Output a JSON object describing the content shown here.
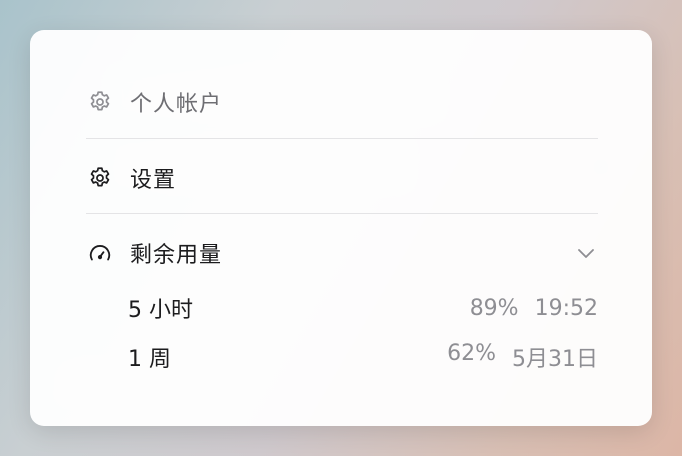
{
  "menu": {
    "account_label": "个人帐户",
    "settings_label": "设置",
    "usage_label": "剩余用量"
  },
  "usage": [
    {
      "name": "5 小时",
      "percent": "89%",
      "reset": "19:52"
    },
    {
      "name": "1 周",
      "percent": "62%",
      "reset": "5月31日"
    }
  ],
  "colors": {
    "panel_bg": "#ffffff",
    "text_primary": "#1c1c1e",
    "text_secondary": "#8e8e93",
    "icon_muted": "#8e8e93"
  },
  "icons": {
    "account": "gear-icon",
    "settings": "gear-icon",
    "usage": "gauge-icon",
    "expand": "chevron-down-icon"
  }
}
